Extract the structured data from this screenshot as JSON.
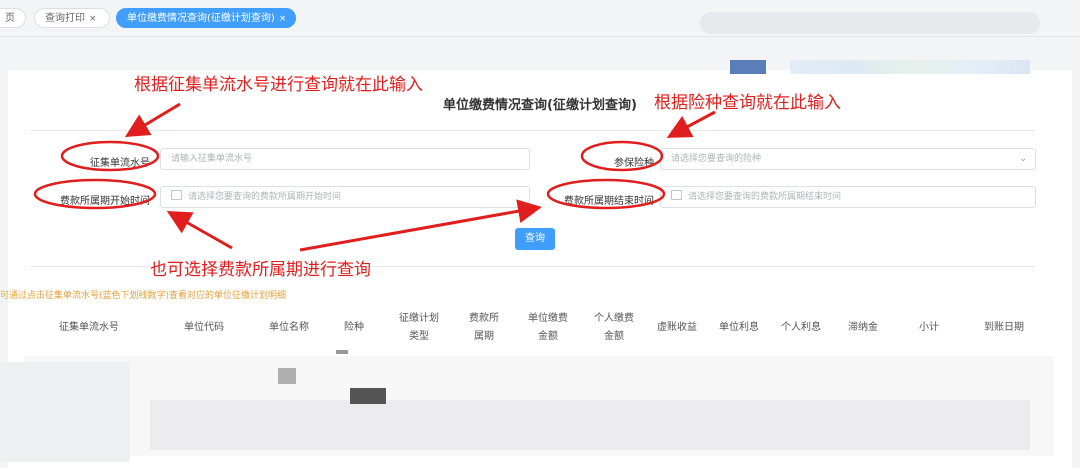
{
  "tabs": [
    {
      "label": "页",
      "close": ""
    },
    {
      "label": "查询打印",
      "close": "×"
    },
    {
      "label": "单位缴费情况查询(征缴计划查询)",
      "close": "×"
    }
  ],
  "page": {
    "title": "单位缴费情况查询(征缴计划查询)"
  },
  "form": {
    "serial_label": "征集单流水号",
    "serial_placeholder": "请输入征集单流水号",
    "insurance_label": "参保险种",
    "insurance_placeholder": "请选择您要查询的险种",
    "start_label": "费款所属期开始时间",
    "start_placeholder": "请选择您要查询的费款所属期开始时间",
    "end_label": "费款所属期结束时间",
    "end_placeholder": "请选择您要查询的费款所属期结束时间",
    "query_button": "查询"
  },
  "hint": "可通过点击征集单流水号(蓝色下划线数字)查看对应的单位征缴计划明细",
  "table": {
    "headers": [
      "征集单流水号",
      "单位代码",
      "单位名称",
      "险种",
      "征缴计划\n类型",
      "费款所\n属期",
      "单位缴费\n金额",
      "个人缴费\n金额",
      "虚账收益",
      "单位利息",
      "个人利息",
      "滞纳金",
      "小计",
      "到账日期"
    ]
  },
  "annotations": {
    "serial_note": "根据征集单流水号进行查询就在此输入",
    "insurance_note": "根据险种查询就在此输入",
    "period_note": "也可选择费款所属期进行查询"
  },
  "colors": {
    "accent": "#409eff",
    "annotation": "#e11e1e",
    "hint": "#e6a23c"
  }
}
